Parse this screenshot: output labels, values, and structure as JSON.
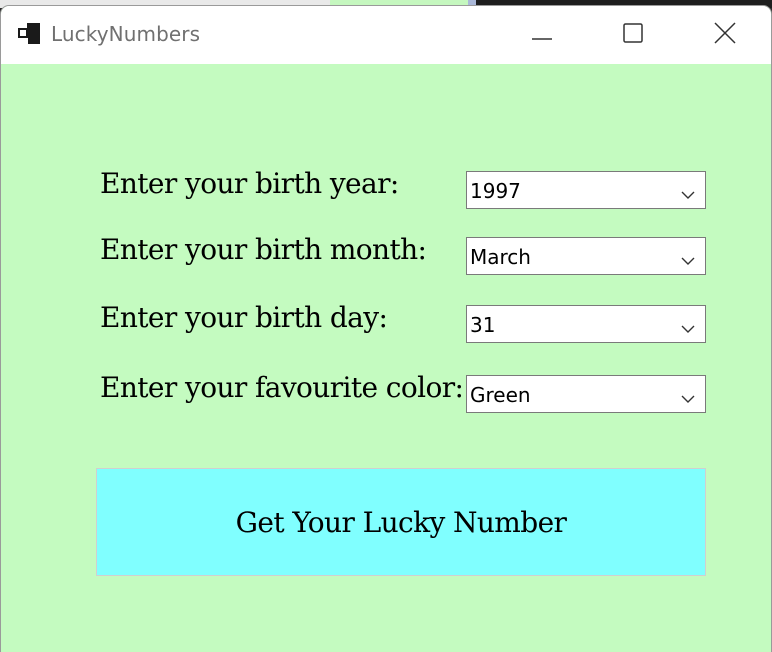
{
  "window": {
    "title": "LuckyNumbers",
    "background_color": "#c4fbc0"
  },
  "form": {
    "fields": [
      {
        "label": "Enter your birth year:",
        "value": "1997"
      },
      {
        "label": "Enter your birth month:",
        "value": "March"
      },
      {
        "label": "Enter your birth day:",
        "value": "31"
      },
      {
        "label": "Enter your favourite color:",
        "value": "Green"
      }
    ]
  },
  "action": {
    "label": "Get Your Lucky Number",
    "color": "#80ffff"
  },
  "icons": {
    "app": "app-icon",
    "minimize": "minimize-icon",
    "maximize": "maximize-icon",
    "close": "close-icon",
    "dropdown": "chevron-down-icon"
  }
}
